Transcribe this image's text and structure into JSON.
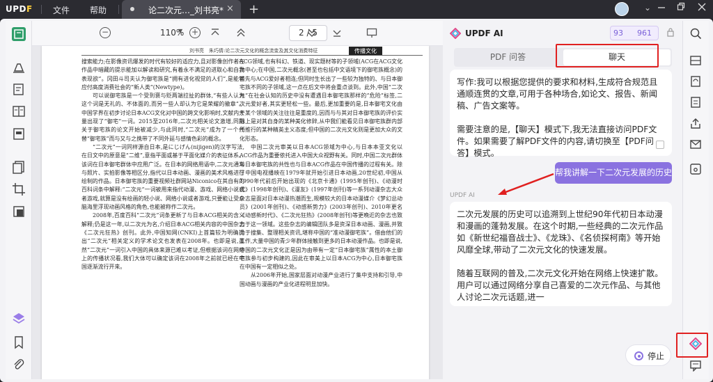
{
  "titlebar": {
    "logo_text": "UPD",
    "logo_accent": "F",
    "menu_file": "文件",
    "menu_help": "帮助",
    "tab_title": "论二次元…_刘书亮*",
    "tab_close": "×",
    "new_tab": "+",
    "dropdown": "⌄"
  },
  "toolbar": {
    "zoom": "110%",
    "page_current": "2",
    "page_separator": "/",
    "page_total": "5"
  },
  "document": {
    "running_head": "刘书亮　朱巧倩:论二次元文化的概念流变及其文化消费特征",
    "running_tag": "传播文化",
    "col1": [
      "搜索能力;在影像资讯爆发的时代有较好的适应力,且对影像创作者在作品中暗藏的提示能加以解读和研究,有着永不满足的进取心和自我表现欲”。冈田斗司夫认为御宅族是“拥有进化视觉的人们”,是能够应付高度消费社会的“新人类”(Newtype)。",
      "可以说御宅族是一个受到褒与贬两端拉扯的群体,“有些人认为这个词是无礼的、不体面的,而另一些人却认为它是荣耀的徽章”。中国学界在初步讨论日本ACG文化对中国的跨文化影响时,文献内大量出现了“御宅”一词。2015至2016年,二次元相关论文激增,同期关于御宅族的论文开始被减少,与此同时,“二次元”成为了一个代替“御宅族”而与又与之携带了不同外延与感情色彩的概念。",
      "“二次元”一词同样源自日本,是にじげん(nijigen)的汉字写法,在日文中的原意是“二维”,意指平面或基于平面化媒介的表征体系。该词在日本御宅群体中应用广泛。在日本的网络用语中,二次元通常与照片、实拍影像等相区分,指代以日本动画、漫画的美术风格进行绘制的作品。日本御宅族的重要视频社群网站Niconico在其自有的百科词条中解释:“二次元”一词被用来指代动漫、游戏、网络小说或者游戏,就算是没有绘画的轻小说、网络小说或者游戏,只要能让受众脑海里浮现动画风格的角色,也能被称作二次元。",
      "2008年,百度百科“二次元”词条更新了与日本ACG相关的含义解释;仍是这一年,以二次元为名,介绍日本ACG相关内容的中国杂志《二次元狂热》创刊。此外,中国知网(CNKI)上首篇较为明确提出“二次元”相关定义的学术论文也发表在2008年。也即是说,虽然“二次元”一词引入中国的具体来源已难以考证,但根据该词在网络上的传播状况看,我们大体可以确定该词在2008年之前就已经在中国逐渐流行开来。"
    ],
    "col2": [
      "ACG领域,也有科幻、铁道、现实题材等的子领域(ACG在ACG文化为中心;在中国,二次元概念(甚至也包括中文语境下的御宅族概念)的首先与ACG爱好者相连;但同时生长出了一些较为独特的、与日本御宅族不同的子领域,这一点在后文中将会重点谈到。此外,中国“二次元”在社会认知的历史中没有遭遇日本御宅族那样的“危险”标签,二次元爱好者,其实更轻松一些。最后,更加重要的是,日本御宅文化由于某个领域的关注往往是重度的,因而与与其对日本御宅族的评价实际上是对其自身的某种美化修辞,从中我们能看见日本御宅族群内部所推行的某种精英主义态度;但中国的二次元文化则是更加大众的文化形态。",
      "中国二次元审美以日本ACG领域为中心,与日本本亚文化以ACG作品为重要依托进入中国大众视野有关。同时,中国二次元群体与日本御宅族的共性也与日本ACG作品在中国传播的过程有关。除了中国电视播映在1979年就开始引进日本动画,20世纪初,中国从1990年代前后开始出现的《北京卡通》(1995年创刊)、《动漫时代》(1998年创刊)、《漫友》(1997年创刊)等一系列动漫杂志大众杂志是面对日本动漫热潮而生,规模较大的日本动漫媒介《梦幻总动员》(2001年创刊)、《动感新势力》(2003年创刊)、2010年更名《动感新时代》、《二次元狂热》(2008年创刊)等更晚近的杂志也致力于这一领域。这些杂志的编辑团队多是资深日本动画、漫画,并致力于搜集、整理相关资讯,堪称中国的“准动漫御宅族”。借由他们的工作,大量中国的青少年群体接触到更多的日本动漫作品。也即是说,中国的二次元文化正是因为由带有一定“日本御宅族”属性的本土御宅族参与初步构建的,因此在审美上以日本ACG为中心,日本御宅族在中国有一定相似之处。",
      "从2006年开始,国家层面对动漫产业进行了集中支持和引导,中国动画与漫画的产业化进程明显加快。"
    ]
  },
  "ai_panel": {
    "title": "UPDF AI",
    "quota_a": "93",
    "quota_b": "961",
    "tab_pdf": "PDF 问答",
    "tab_chat": "聊天",
    "msg1_p1": "写作:我可以根据您提供的要求和材料,生成符合规范且通顺连贯的文章,可用于各种场合,如论文、报告、新闻稿、广告文案等。",
    "msg1_p2": "需要注意的是,【聊天】模式下,我无法直接访问PDF文件。如果需要了解PDF文件的内容,请切换至【PDF问答】模式。",
    "user_msg": "帮我讲解一下二次元发展的历史",
    "ai_label": "UPDF AI",
    "msg2_p1": "二次元发展的历史可以追溯到上世纪90年代初日本动漫和漫画的蓬勃发展。在这个时期,一些经典的二次元作品如《新世纪福音战士》、《龙珠》、《名侦探柯南》等开始风靡全球,带动了二次元文化的快速发展。",
    "msg2_p2": "随着互联网的普及,二次元文化开始在网络上快速扩散。用户可以通过网络分享自己喜爱的二次元作品、与其他人讨论二次元话题,进一",
    "stop_label": "停止"
  },
  "colors": {
    "accent": "#8a72e0",
    "highlight": "#e02020",
    "titlebar": "#2b2b31"
  }
}
